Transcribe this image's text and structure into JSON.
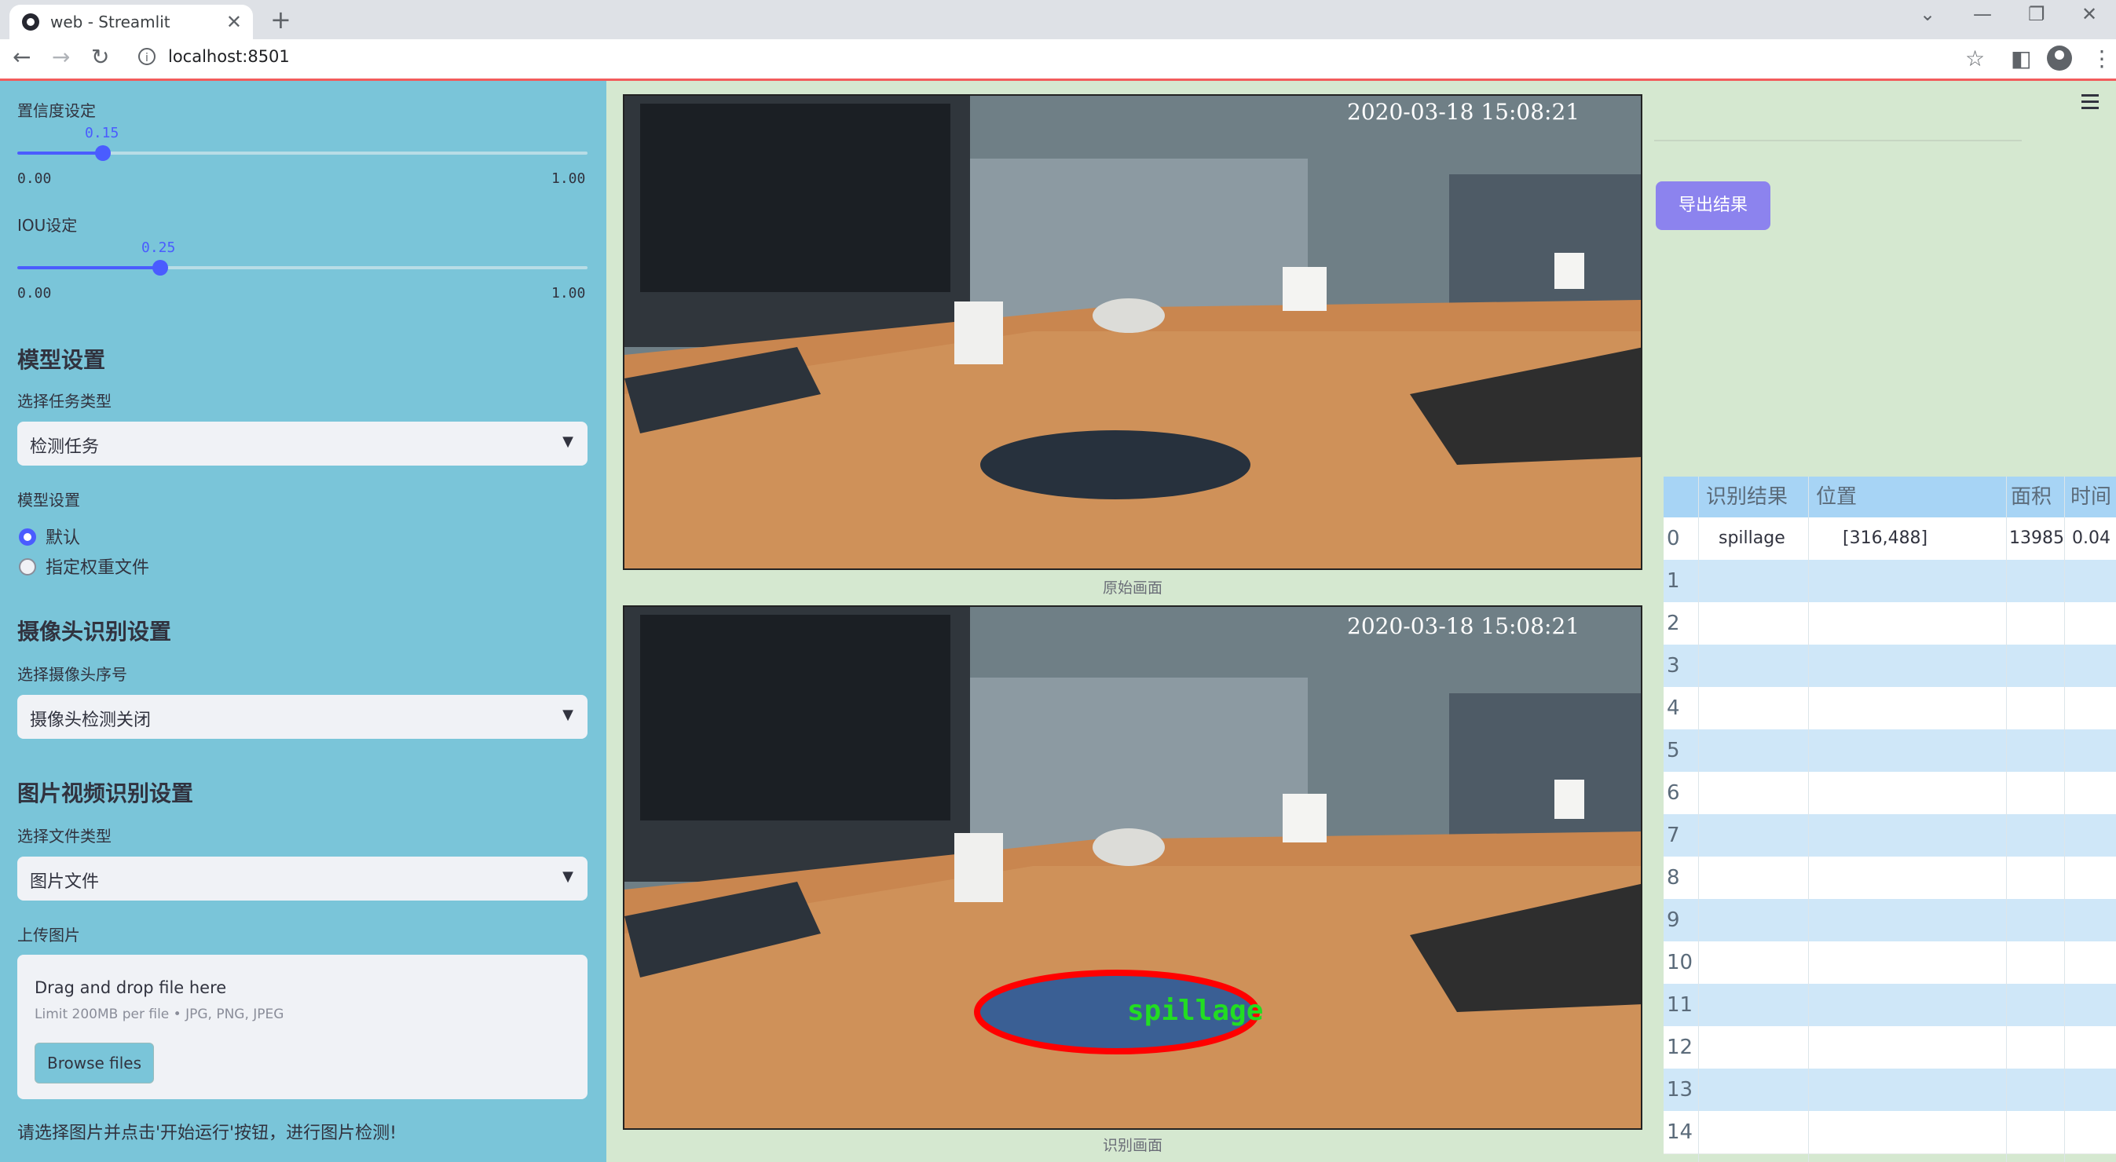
{
  "browser": {
    "tab_title": "web - Streamlit",
    "url": "localhost:8501"
  },
  "sidebar": {
    "confidence": {
      "label": "置信度设定",
      "value": "0.15",
      "min": "0.00",
      "max": "1.00",
      "fraction": 0.15
    },
    "iou": {
      "label": "IOU设定",
      "value": "0.25",
      "min": "0.00",
      "max": "1.00",
      "fraction": 0.25
    },
    "model_section": "模型设置",
    "task_label": "选择任务类型",
    "task_value": "检测任务",
    "model_label": "模型设置",
    "model_options": [
      {
        "label": "默认",
        "selected": true
      },
      {
        "label": "指定权重文件",
        "selected": false
      }
    ],
    "camera_section": "摄像头识别设置",
    "camera_label": "选择摄像头序号",
    "camera_value": "摄像头检测关闭",
    "file_section": "图片视频识别设置",
    "filetype_label": "选择文件类型",
    "filetype_value": "图片文件",
    "upload_label": "上传图片",
    "upload_title": "Drag and drop file here",
    "upload_limit": "Limit 200MB per file • JPG, PNG, JPEG",
    "browse_button": "Browse files",
    "footer_hint": "请选择图片并点击'开始运行'按钮，进行图片检测!"
  },
  "main": {
    "timestamp": "2020-03-18  15:08:21",
    "original_caption": "原始画面",
    "result_caption": "识别画面",
    "detection_label": "spillage",
    "export_button": "导出结果"
  },
  "table": {
    "headers": [
      "识别结果",
      "位置",
      "面积",
      "时间"
    ],
    "rows": [
      {
        "index": "0",
        "result": "spillage",
        "position": "[316,488]",
        "area": "13985",
        "time": "0.04"
      },
      {
        "index": "1"
      },
      {
        "index": "2"
      },
      {
        "index": "3"
      },
      {
        "index": "4"
      },
      {
        "index": "5"
      },
      {
        "index": "6"
      },
      {
        "index": "7"
      },
      {
        "index": "8"
      },
      {
        "index": "9"
      },
      {
        "index": "10"
      },
      {
        "index": "11"
      },
      {
        "index": "12"
      },
      {
        "index": "13"
      },
      {
        "index": "14"
      }
    ]
  },
  "colors": {
    "sidebar_bg": "#7ac5d9",
    "accent": "#4a5cff",
    "export_button": "#8c83ee",
    "detection_outline": "#ff0000",
    "detection_text": "#22dd22"
  }
}
